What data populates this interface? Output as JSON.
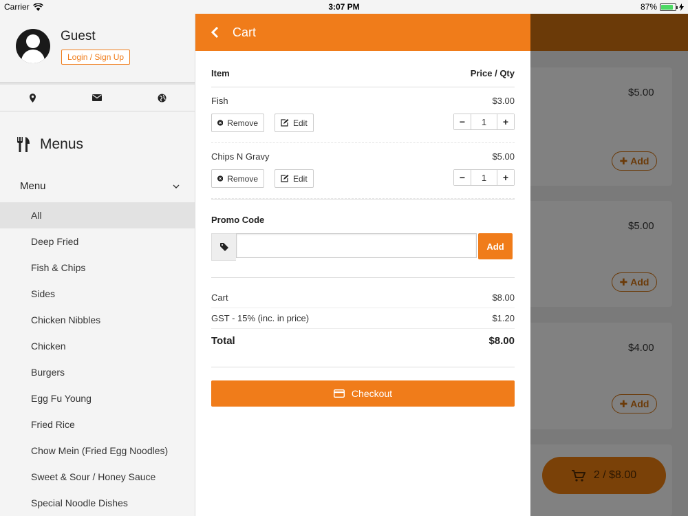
{
  "status_bar": {
    "carrier": "Carrier",
    "time": "3:07 PM",
    "battery": "87%",
    "battery_level": 0.87
  },
  "sidebar": {
    "user_name": "Guest",
    "login_label": "Login / Sign Up",
    "icons": [
      "location-pin-icon",
      "envelope-icon",
      "globe-icon"
    ],
    "menus_title": "Menus",
    "menu_dropdown_label": "Menu",
    "categories": [
      "All",
      "Deep Fried",
      "Fish & Chips",
      "Sides",
      "Chicken Nibbles",
      "Chicken",
      "Burgers",
      "Egg Fu Young",
      "Fried Rice",
      "Chow Mein (Fried Egg Noodles)",
      "Sweet & Sour / Honey Sauce",
      "Special Noodle Dishes"
    ],
    "active_category": "All"
  },
  "cart": {
    "title": "Cart",
    "col_item": "Item",
    "col_price_qty": "Price / Qty",
    "items": [
      {
        "name": "Fish",
        "price": "$3.00",
        "qty": "1"
      },
      {
        "name": "Chips N Gravy",
        "price": "$5.00",
        "qty": "1"
      }
    ],
    "remove_label": "Remove",
    "edit_label": "Edit",
    "minus_label": "−",
    "plus_label": "+",
    "promo_label": "Promo Code",
    "promo_value": "",
    "promo_add_label": "Add",
    "cart_label": "Cart",
    "cart_amount": "$8.00",
    "gst_label": "GST - 15% (inc. in price)",
    "gst_amount": "$1.20",
    "total_label": "Total",
    "total_amount": "$8.00",
    "checkout_label": "Checkout"
  },
  "background": {
    "prices": [
      "$5.00",
      "$5.00",
      "$4.00"
    ],
    "add_label": "Add",
    "cart_fab_label": "2 / $8.00"
  },
  "colors": {
    "accent": "#f07c1a",
    "dim_header": "#6b3a08"
  }
}
